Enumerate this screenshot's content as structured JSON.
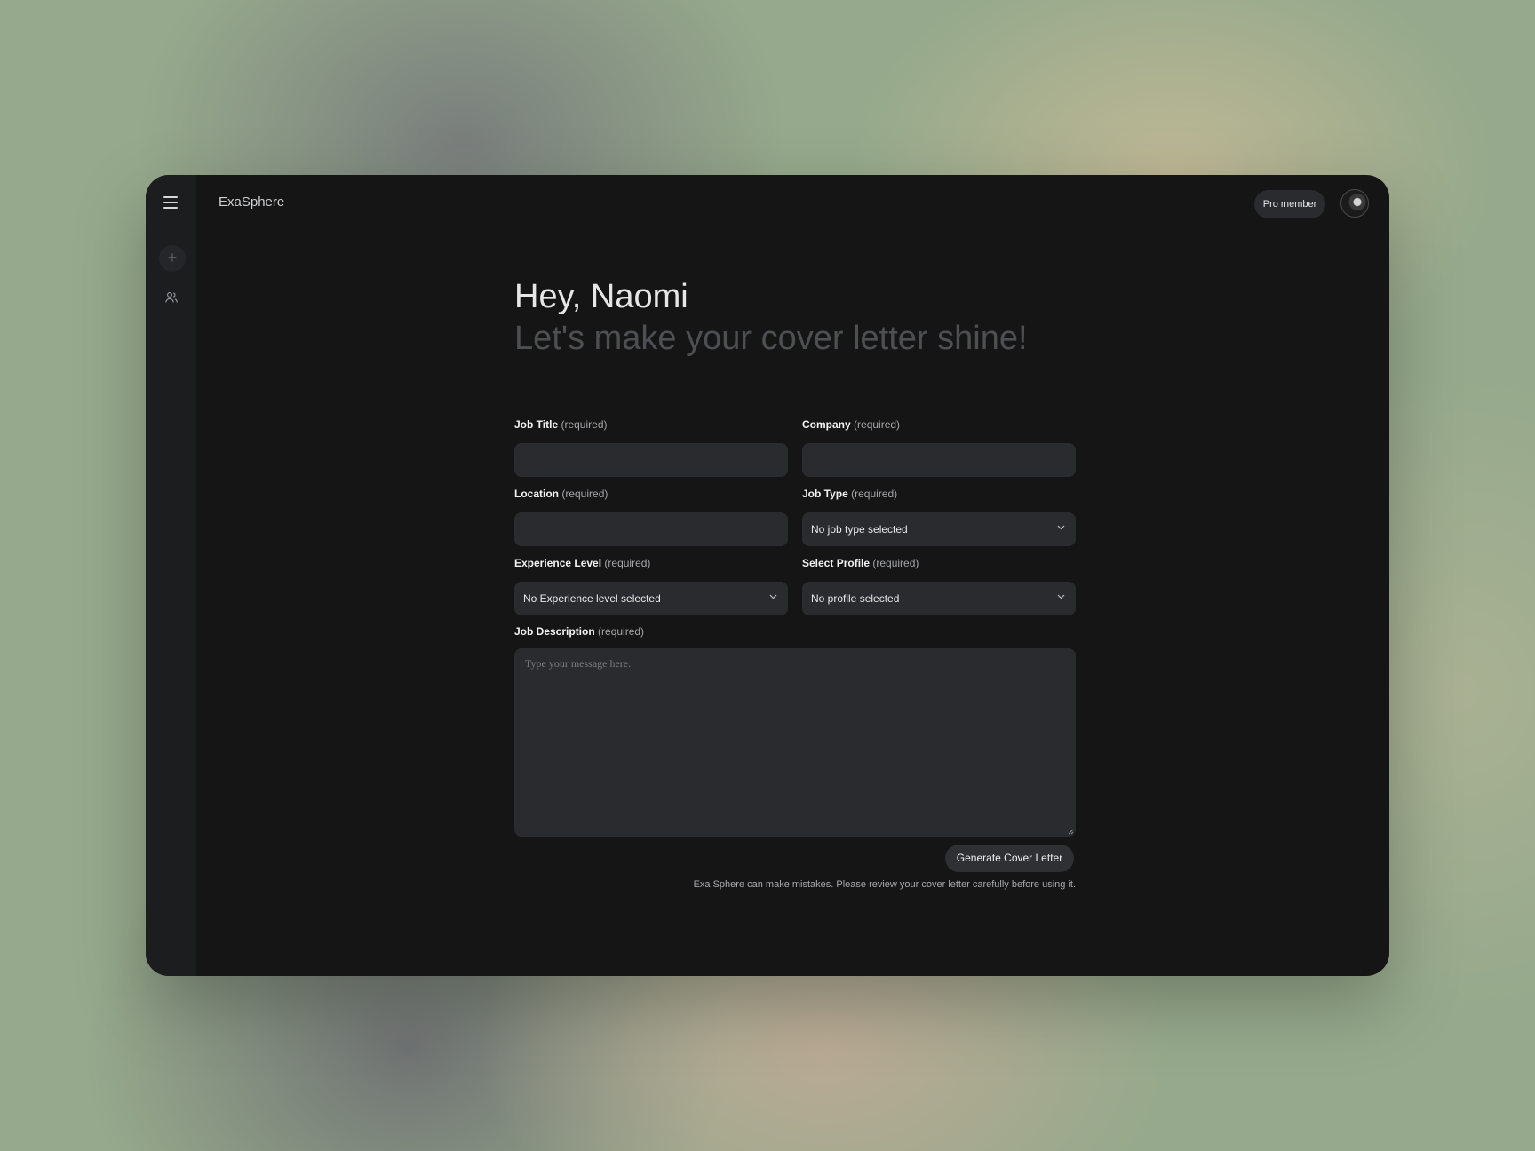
{
  "app": {
    "brand": "ExaSphere"
  },
  "header": {
    "badge": "Pro member"
  },
  "hero": {
    "greeting": "Hey, Naomi",
    "subtitle": "Let's make your cover letter shine!"
  },
  "form": {
    "required_suffix": "(required)",
    "job_title": {
      "label": "Job Title",
      "value": ""
    },
    "company": {
      "label": "Company",
      "value": ""
    },
    "location": {
      "label": "Location",
      "value": ""
    },
    "job_type": {
      "label": "Job Type",
      "selected": "No job type selected"
    },
    "experience_level": {
      "label": "Experience Level",
      "selected": "No Experience level selected"
    },
    "profile": {
      "label": "Select Profile",
      "selected": "No profile selected"
    },
    "job_description": {
      "label": "Job Description",
      "placeholder": "Type your message here."
    },
    "submit_label": "Generate Cover Letter",
    "disclaimer": "Exa Sphere can make mistakes. Please review your cover letter carefully before using it."
  },
  "icons": [
    "menu-icon",
    "plus-icon",
    "users-icon",
    "chevron-down-icon",
    "avatar"
  ],
  "colors": {
    "window_bg": "#151516",
    "sidebar_bg": "#1c1d1f",
    "field_bg": "#2a2b2e",
    "subtitle": "#4e4f52"
  }
}
